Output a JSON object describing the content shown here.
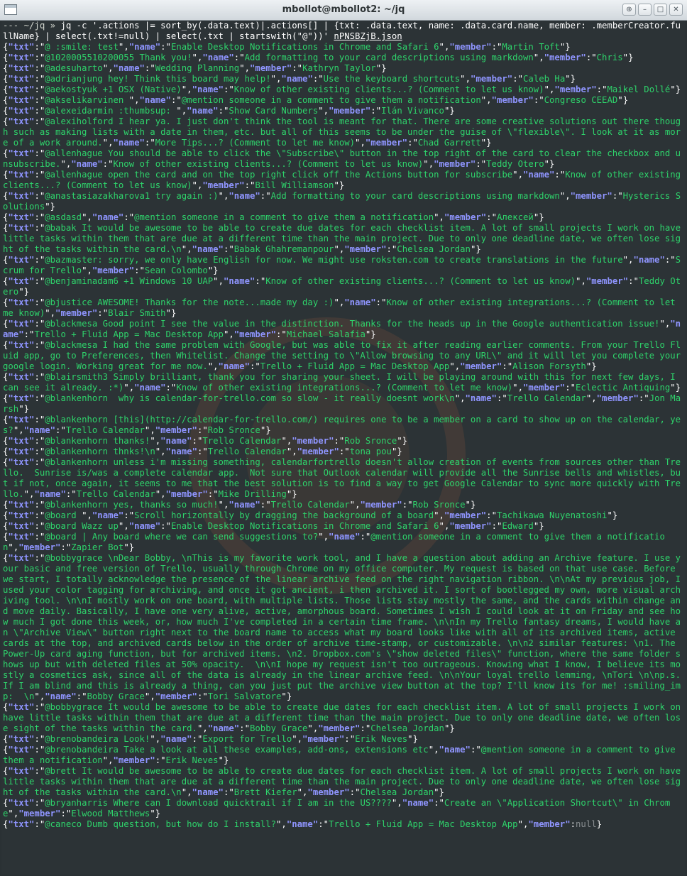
{
  "window": {
    "title": "mbollot@mbollot2: ~/jq",
    "buttons": [
      "⊕",
      "–",
      "□",
      "✕"
    ]
  },
  "terminal": {
    "prompt": {
      "prefix": "--- ",
      "path": "~/jq",
      "sep": " » ",
      "command": "jq -c '.actions |= sort_by(.data.text)|.actions[] | {txt: .data.text, name: .data.card.name, member: .memberCreator.fullName} | select(.txt!=null) | select(.txt | startswith(\"@\"))' ",
      "file": "nPNSBZjB.json"
    },
    "rows": [
      {
        "txt": "@ :smile: test",
        "name": "Enable Desktop Notifications in Chrome and Safari 6",
        "member": "Martin Toft"
      },
      {
        "txt": "@1020005510200055 Thank you!",
        "name": "Add formatting to your card descriptions using markdown",
        "member": "Chris"
      },
      {
        "txt": "@adesuharto",
        "name": "Wedding Planning",
        "member": "Kathryn Taylor"
      },
      {
        "txt": "@adrianjung hey! Think this board may help!",
        "name": "Use the keyboard shortcuts",
        "member": "Caleb Ha"
      },
      {
        "txt": "@aekostyuk +1 OSX (Native)",
        "name": "Know of other existing clients...? (Comment to let us know)",
        "member": "Maikel Dollé"
      },
      {
        "txt": "@akselikarvinen ",
        "name": "@mention someone in a comment to give them a notification",
        "member": "Congreso CEEAD"
      },
      {
        "txt": "@alexeidarmin :thumbsup: ",
        "name": "Show Card Numbers",
        "member": "Ilán Vivanco"
      },
      {
        "txt": "@alexiholford I hear ya. I just don't think the tool is meant for that. There are some creative solutions out there though such as making lists with a date in them, etc. but all of this seems to be under the guise of \\\"flexible\\\". I look at it as more of a work around.",
        "name": "More Tips...? (Comment to let me know)",
        "member": "Chad Garrett"
      },
      {
        "txt": "@allenhague You should be able to click the \\\"Subscribe\\\" button in the top right of the card to clear the checkbox and unsubscribe.",
        "name": "Know of other existing clients...? (Comment to let us know)",
        "member": "Teddy Otero"
      },
      {
        "txt": "@allenhague open the card and on the top right click off the Actions button for subscribe",
        "name": "Know of other existing clients...? (Comment to let us know)",
        "member": "Bill Williamson"
      },
      {
        "txt": "@anastasiazakharova1 try again :)",
        "name": "Add formatting to your card descriptions using markdown",
        "member": "Hysterics Solutions"
      },
      {
        "txt": "@asdasd",
        "name": "@mention someone in a comment to give them a notification",
        "member": "Алексей"
      },
      {
        "txt": "@babak It would be awesome to be able to create due dates for each checklist item. A lot of small projects I work on have little tasks within them that are due at a different time than the main project. Due to only one deadline date, we often lose sight of the tasks within the card.\\n",
        "name": "Babak Ghahremanpour",
        "member": "Chelsea Jordan"
      },
      {
        "txt": "@bazmaster: sorry, we only have English for now. We might use roksten.com to create translations in the future",
        "name": "Scrum for Trello",
        "member": "Sean Colombo"
      },
      {
        "txt": "@benjaminadam6 +1 Windows 10 UAP",
        "name": "Know of other existing clients...? (Comment to let us know)",
        "member": "Teddy Otero"
      },
      {
        "txt": "@bjustice AWESOME! Thanks for the note...made my day :)",
        "name": "Know of other existing integrations...? (Comment to let me know)",
        "member": "Blair Smith"
      },
      {
        "txt": "@blackmesa Good point I see the value in the distinction. Thanks for the heads up in the Google authentication issue!",
        "name": "Trello + Fluid App = Mac Desktop App",
        "member": "Michael Salafia"
      },
      {
        "txt": "@blackmesa I had the same problem with Google, but was able to fix it after reading earlier comments. From your Trello Fluid app, go to Preferences, then Whitelist. Change the setting to \\\"Allow browsing to any URL\\\" and it will let you complete your google login. Working great for me now.",
        "name": "Trello + Fluid App = Mac Desktop App",
        "member": "Alison Forsyth"
      },
      {
        "txt": "@blairsmith3 Simply brilliant, thank you for sharing your sheet. I will be playing around with this for next few days, I can see it already. :*)",
        "name": "Know of other existing integrations...? (Comment to let me know)",
        "member": "Eclectic Antiquing"
      },
      {
        "txt": "@blankenhorn  why is calendar-for-trello.com so slow - it really doesnt work\\n",
        "name": "Trello Calendar",
        "member": "Jon Marsh"
      },
      {
        "txt": "@blankenhorn [this](http://calendar-for-trello.com/) requires one to be a member on a card to show up on the calendar, yes?",
        "name": "Trello Calendar",
        "member": "Rob Sronce"
      },
      {
        "txt": "@blankenhorn thanks!",
        "name": "Trello Calendar",
        "member": "Rob Sronce"
      },
      {
        "txt": "@blankenhorn thnks!\\n",
        "name": "Trello Calendar",
        "member": "tona pou"
      },
      {
        "txt": "@blankenhorn unless i'm missing something, calendarfortrello doesn't allow creation of events from sources other than Trello.  Sunrise is/was a complete calendar app.  Not sure that Outlook calendar will provide all the Sunrise bells and whistles, but if not, once again, it seems to me that the best solution is to find a way to get Google Calendar to sync more quickly with Trello.",
        "name": "Trello Calendar",
        "member": "Mike Drilling"
      },
      {
        "txt": "@blankenhorn yes, thanks so much!",
        "name": "Trello Calendar",
        "member": "Rob Sronce"
      },
      {
        "txt": "@board ",
        "name": "Scroll horizontally by dragging the background of a board",
        "member": "Tachikawa Nuyenatoshi"
      },
      {
        "txt": "@board Wazz up",
        "name": "Enable Desktop Notifications in Chrome and Safari 6",
        "member": "Edward"
      },
      {
        "txt": "@board | Any board where we can send suggestions to?",
        "name": "@mention someone in a comment to give them a notification",
        "member": "Zapier Bot"
      },
      {
        "txt": "@bobbygrace \\nDear Bobby, \\nThis is my favorite work tool, and I have a question about adding an Archive feature. I use your basic and free version of Trello, usually through Chrome on my office computer. My request is based on that use case. Before we start, I totally acknowledge the presence of the linear archive feed on the right navigation ribbon. \\n\\nAt my previous job, I used your color tagging for archiving, and once it got ancient, i then archived it. I sort of bootlegged my own, more visual archiving tool. \\n\\nI mostly work on one board, with multiple lists. Those lists stay mostly the same, and the cards within change and move daily. Basically, I have one very alive, active, amorphous board. Sometimes I wish I could look at it on Friday and see how much I got done this week, or, how much I've completed in a certain time frame. \\n\\nIn my Trello fantasy dreams, I would have an \\\"Archive View\\\" button right next to the board name to access what my board looks like with all of its archived items, active cards at the top, and archived cards below in the order of archive time-stamp, or customizable. \\n\\n2 similar features: \\n1. The Power-Up card aging function, but for archived items. \\n2. Dropbox.com's \\\"show deleted files\\\" function, where the same folder shows up but with deleted files at 50% opacity.  \\n\\nI hope my request isn't too outrageous. Knowing what I know, I believe its mostly a cosmetics ask, since all of the data is already in the linear archive feed. \\n\\nYour loyal trello lemming, \\nTori \\n\\np.s. If I am blind and this is already a thing, can you just put the archive view button at the top? I'll know its for me! :smiling_imp:  \\n",
        "name": "Bobby Grace",
        "member": "Tori Salvatore"
      },
      {
        "txt": "@bobbygrace It would be awesome to be able to create due dates for each checklist item. A lot of small projects I work on have little tasks within them that are due at a different time than the main project. Due to only one deadline date, we often lose sight of the tasks within the card.",
        "name": "Bobby Grace",
        "member": "Chelsea Jordan"
      },
      {
        "txt": "@brenobandeira Look!",
        "name": "Export for Trello",
        "member": "Erik Neves"
      },
      {
        "txt": "@brenobandeira Take a look at all these examples, add-ons, extensions etc",
        "name": "@mention someone in a comment to give them a notification",
        "member": "Erik Neves"
      },
      {
        "txt": "@brett It would be awesome to be able to create due dates for each checklist item. A lot of small projects I work on have little tasks within them that are due at a different time than the main project. Due to only one deadline date, we often lose sight of the tasks within the card.\\n",
        "name": "Brett Kiefer",
        "member": "Chelsea Jordan"
      },
      {
        "txt": "@bryanharris Where can I download quicktrail if I am in the US????",
        "name": "Create an \\\"Application Shortcut\\\" in Chrome",
        "member": "Elwood Matthews"
      },
      {
        "txt": "@caneco Dumb question, but how do I install?",
        "name": "Trello + Fluid App = Mac Desktop App",
        "member": null
      }
    ]
  }
}
